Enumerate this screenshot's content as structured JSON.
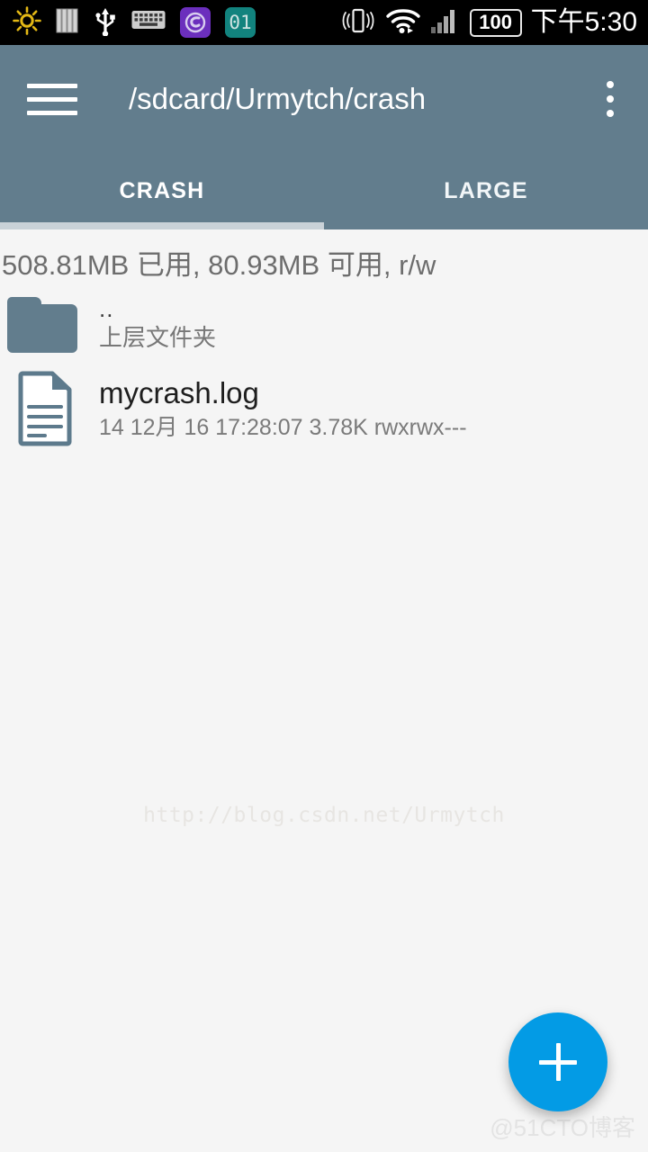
{
  "status_bar": {
    "icons": [
      {
        "name": "brightness-sun-icon",
        "color": "#e3b815"
      },
      {
        "name": "bars-vertical-icon",
        "color": "#cfcfcf"
      },
      {
        "name": "usb-icon",
        "color": "#ffffff"
      },
      {
        "name": "keyboard-icon",
        "color": "#cccccc"
      },
      {
        "name": "app-swirl-icon",
        "color": "#6b2fbd"
      },
      {
        "name": "app-counter-icon",
        "color": "#12837e",
        "label": "01"
      }
    ],
    "vibrate_icon": "vibrate-icon",
    "wifi_icon": "wifi-icon",
    "signal_icon": "cellular-signal-icon",
    "battery_level": "100",
    "clock": "下午5:30"
  },
  "app_bar": {
    "menu_icon": "hamburger-menu-icon",
    "title": "/sdcard/Urmytch/crash",
    "overflow_icon": "overflow-menu-icon",
    "background_color": "#627d8d"
  },
  "tabs": {
    "items": [
      {
        "label": "CRASH",
        "active": true
      },
      {
        "label": "LARGE",
        "active": false
      }
    ],
    "indicator_color": "#c9d2d8"
  },
  "storage": {
    "summary": "508.81MB 已用, 80.93MB 可用, r/w"
  },
  "file_list": {
    "parent": {
      "icon": "folder-icon",
      "name": "..",
      "subtitle": "上层文件夹"
    },
    "files": [
      {
        "icon": "file-document-icon",
        "name": "mycrash.log",
        "meta": "14 12月 16 17:28:07  3.78K  rwxrwx---"
      }
    ]
  },
  "watermarks": {
    "center": "http://blog.csdn.net/Urmytch",
    "corner": "@51CTO博客"
  },
  "fab": {
    "icon": "add-plus-icon",
    "color": "#039BE5"
  }
}
